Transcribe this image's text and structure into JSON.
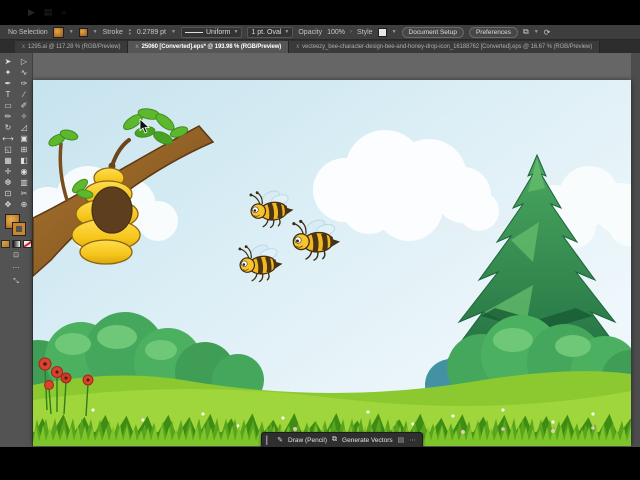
{
  "control_bar": {
    "selection_status": "No Selection",
    "stroke_label": "Stroke",
    "stroke_weight": "0.2789 pt",
    "stroke_profile": "Uniform",
    "brush_definition": "1 pt. Oval",
    "opacity_label": "Opacity",
    "opacity_value": "100%",
    "style_label": "Style",
    "document_setup_label": "Document Setup",
    "preferences_label": "Preferences"
  },
  "tabs": [
    {
      "label": "1295.ai @ 117.28 % (RGB/Preview)",
      "active": false
    },
    {
      "label": "25060 [Converted].eps* @ 193.98 % (RGB/Preview)",
      "active": true
    },
    {
      "label": "vecteezy_bee-character-design-bee-and-honey-drop-icon_16188762 [Converted].eps @ 16.67 % (RGB/Preview)",
      "active": false
    }
  ],
  "tab_close_glyph": "x",
  "toolbar": {
    "tools": [
      {
        "name": "selection-tool",
        "glyph": "➤"
      },
      {
        "name": "direct-selection-tool",
        "glyph": "▷"
      },
      {
        "name": "magic-wand-tool",
        "glyph": "✦"
      },
      {
        "name": "lasso-tool",
        "glyph": "∿"
      },
      {
        "name": "pen-tool",
        "glyph": "✒"
      },
      {
        "name": "curvature-tool",
        "glyph": "✑"
      },
      {
        "name": "type-tool",
        "glyph": "T"
      },
      {
        "name": "line-segment-tool",
        "glyph": "∕"
      },
      {
        "name": "rectangle-tool",
        "glyph": "▭"
      },
      {
        "name": "paintbrush-tool",
        "glyph": "✐"
      },
      {
        "name": "pencil-tool",
        "glyph": "✏"
      },
      {
        "name": "shaper-tool",
        "glyph": "✧"
      },
      {
        "name": "rotate-tool",
        "glyph": "↻"
      },
      {
        "name": "scale-tool",
        "glyph": "◿"
      },
      {
        "name": "width-tool",
        "glyph": "⟷"
      },
      {
        "name": "free-transform-tool",
        "glyph": "▣"
      },
      {
        "name": "shape-builder-tool",
        "glyph": "◱"
      },
      {
        "name": "perspective-grid-tool",
        "glyph": "⊞"
      },
      {
        "name": "mesh-tool",
        "glyph": "▦"
      },
      {
        "name": "gradient-tool",
        "glyph": "◧"
      },
      {
        "name": "eyedropper-tool",
        "glyph": "✛"
      },
      {
        "name": "blend-tool",
        "glyph": "◉"
      },
      {
        "name": "symbol-sprayer-tool",
        "glyph": "❆"
      },
      {
        "name": "column-graph-tool",
        "glyph": "▥"
      },
      {
        "name": "artboard-tool",
        "glyph": "⊡"
      },
      {
        "name": "slice-tool",
        "glyph": "✂"
      },
      {
        "name": "hand-tool",
        "glyph": "✥"
      },
      {
        "name": "zoom-tool",
        "glyph": "⊕"
      }
    ],
    "more_glyph": "⋯",
    "collapse_glyph": "⤡"
  },
  "task_bar": {
    "draw_label": "Draw (Pencil)",
    "generate_vectors_label": "Generate Vectors",
    "more_label": "⋯"
  },
  "artwork": {
    "scene": "Cartoon meadow: beehive hanging from tree branch, three flying bees, fir tree, bushes, grass and flowers",
    "colors": {
      "sky_top": "#c6e3ee",
      "sky_bottom": "#eef7fb",
      "cloud": "#ffffff",
      "branch_brown": "#96682c",
      "hive_yellow": "#f6c51b",
      "hive_entrance": "#5d3f1f",
      "bee_yellow": "#f3b71f",
      "bee_stripe": "#4a3416",
      "wing_blue": "#d7ecf5",
      "pine_green": "#2f8a4e",
      "trunk_brown": "#a0741c",
      "bush_green": "#4cb061",
      "bush_teal": "#4292a4",
      "meadow_green": "#9fd63b",
      "grass_fringe": "#5aa51e",
      "poppy_red": "#d84330",
      "ui_accent_fill": "#c8862f"
    }
  }
}
